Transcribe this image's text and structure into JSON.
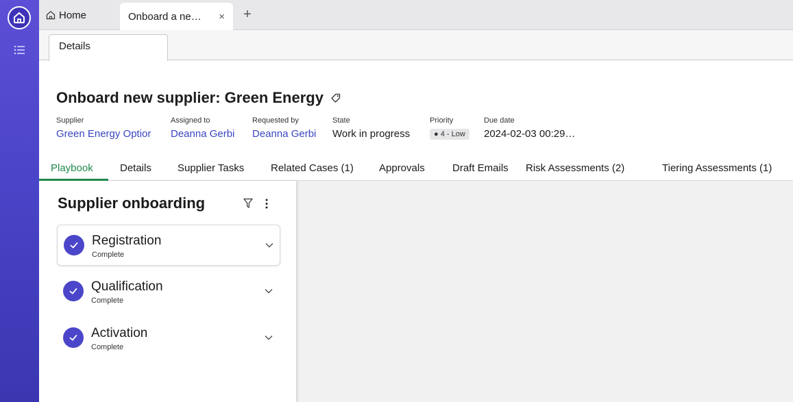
{
  "tabstrip": {
    "home_label": "Home",
    "active_tab_label": "Onboard a ne…",
    "close_glyph": "×",
    "new_tab_glyph": "+"
  },
  "subbar": {
    "tab_label": "Details"
  },
  "record": {
    "title": "Onboard new supplier: Green Energy",
    "fields": [
      {
        "label": "Supplier",
        "value": "Green Energy Optior",
        "link": true
      },
      {
        "label": "Assigned to",
        "value": "Deanna Gerbi",
        "link": true
      },
      {
        "label": "Requested by",
        "value": "Deanna Gerbi",
        "link": true
      },
      {
        "label": "State",
        "value": "Work in progress",
        "link": false
      },
      {
        "label": "Priority",
        "value": "● 4 - Low",
        "link": false
      },
      {
        "label": "Due date",
        "value": "2024-02-03 00:29…",
        "link": false
      }
    ]
  },
  "main_tabs": [
    "Playbook",
    "Details",
    "Supplier Tasks",
    "Related Cases (1)",
    "Approvals",
    "Draft Emails",
    "Risk Assessments (2)",
    "Tiering Assessments (1)"
  ],
  "playbook": {
    "title": "Supplier onboarding",
    "steps": [
      {
        "name": "Registration",
        "status": "Complete"
      },
      {
        "name": "Qualification",
        "status": "Complete"
      },
      {
        "name": "Activation",
        "status": "Complete"
      }
    ]
  },
  "colors": {
    "rail": "#4a44c8",
    "accent_green": "#1f8a4c",
    "link": "#3a45c0",
    "check": "#4b46c9"
  },
  "icons": [
    "home-icon",
    "list-icon",
    "tag-icon",
    "filter-icon",
    "more-vertical-icon",
    "check-circle-icon",
    "chevron-down-icon"
  ]
}
